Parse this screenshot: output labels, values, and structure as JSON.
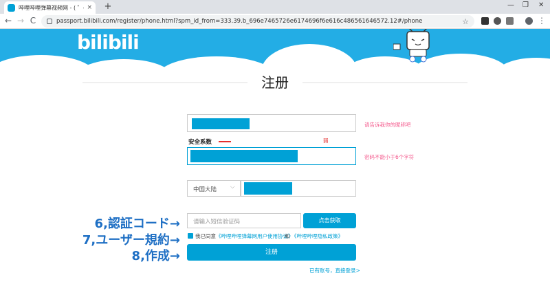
{
  "browser": {
    "tab_title": "哔哩哔哩弹幕视频网 - ( ゜- ゜)つロ",
    "tab_close": "×",
    "new_tab": "+",
    "url": "passport.bilibili.com/register/phone.html?spm_id_from=333.39.b_696e7465726e6174696f6e616c486561646572.12#/phone",
    "back": "←",
    "forward": "→",
    "reload": "C",
    "star": "☆",
    "minimize": "—",
    "maximize": "❐",
    "close": "✕",
    "menu": "⋮"
  },
  "banner": {
    "logo": "bilibili"
  },
  "page": {
    "title": "注册"
  },
  "form": {
    "nickname_hint": "请告诉我你的昵称吧",
    "security_label": "安全系数",
    "strength_level": "弱",
    "password_hint": "密码不能小于6个字符",
    "region_value": "中国大陆",
    "region_caret": "⌵",
    "sms_placeholder": "请输入短信验证码",
    "get_code_button": "点击获取",
    "agree_prefix": "我已同意",
    "agree_terms": "《哔哩哔哩弹幕网用户使用协议》",
    "agree_and": "和",
    "agree_privacy": "《哔哩哔哩隐私政策》",
    "register_button": "注册",
    "login_link": "已有账号，直接登录>"
  },
  "annotations": {
    "step6": "6,認証コード→",
    "step7": "7,ユーザー規約→",
    "step8": "8,作成→"
  },
  "colors": {
    "brand": "#00a1d6",
    "banner": "#23ade5",
    "hint": "#f45a8d",
    "annotation": "#1e6fc4"
  }
}
